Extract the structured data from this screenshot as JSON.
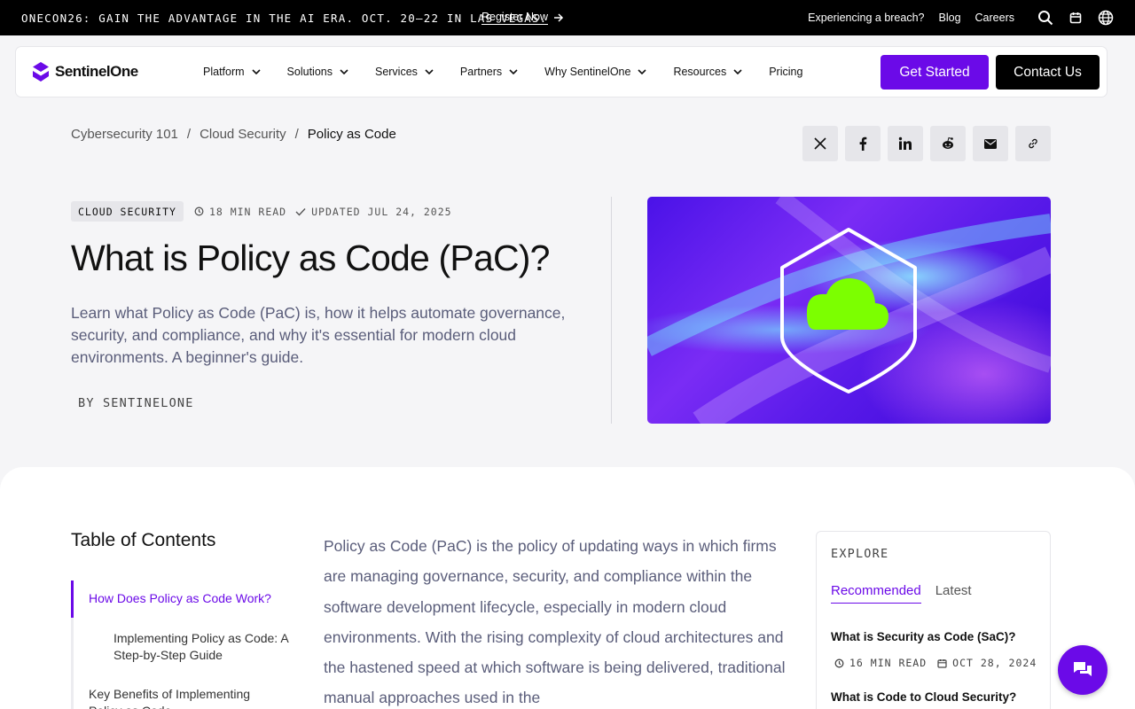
{
  "announcement": {
    "promo": "ONECON26: GAIN THE ADVANTAGE IN THE AI ERA. OCT. 20–22 IN LAS VEGAS.",
    "register": "Register Now",
    "links": [
      "Experiencing a breach?",
      "Blog",
      "Careers"
    ]
  },
  "nav": {
    "logo": "SentinelOne",
    "menu": [
      "Platform",
      "Solutions",
      "Services",
      "Partners",
      "Why SentinelOne",
      "Resources",
      "Pricing"
    ],
    "get_started": "Get Started",
    "contact": "Contact Us"
  },
  "breadcrumb": [
    "Cybersecurity 101",
    "Cloud Security",
    "Policy as Code"
  ],
  "article": {
    "category": "CLOUD SECURITY",
    "read_time": "18 MIN READ",
    "updated": "UPDATED JUL 24, 2025",
    "title": "What is Policy as Code (PaC)?",
    "lede": "Learn what Policy as Code (PaC) is, how it helps automate governance, security, and compliance, and why it's essential for modern cloud environments. A beginner's guide.",
    "byline": "BY SENTINELONE",
    "body": "Policy as Code (PaC) is the policy of updating ways in which firms are managing governance, security, and compliance within the software development lifecycle, especially in modern cloud environments. With the rising complexity of cloud architectures and the hastened speed at which software is being delivered, traditional manual approaches used in the"
  },
  "toc": {
    "title": "Table of Contents",
    "items": [
      "How Does Policy as Code Work?",
      "Implementing Policy as Code: A Step-by-Step Guide",
      "Key Benefits of Implementing Policy as Code"
    ]
  },
  "explore": {
    "label": "EXPLORE",
    "tabs": [
      "Recommended",
      "Latest"
    ],
    "articles": [
      {
        "title": "What is Security as Code (SaC)?",
        "read": "16 MIN READ",
        "date": "OCT 28, 2024"
      },
      {
        "title": "What is Code to Cloud Security?"
      }
    ]
  },
  "colors": {
    "accent": "#6b0ae8",
    "cloud": "#7cff00"
  }
}
